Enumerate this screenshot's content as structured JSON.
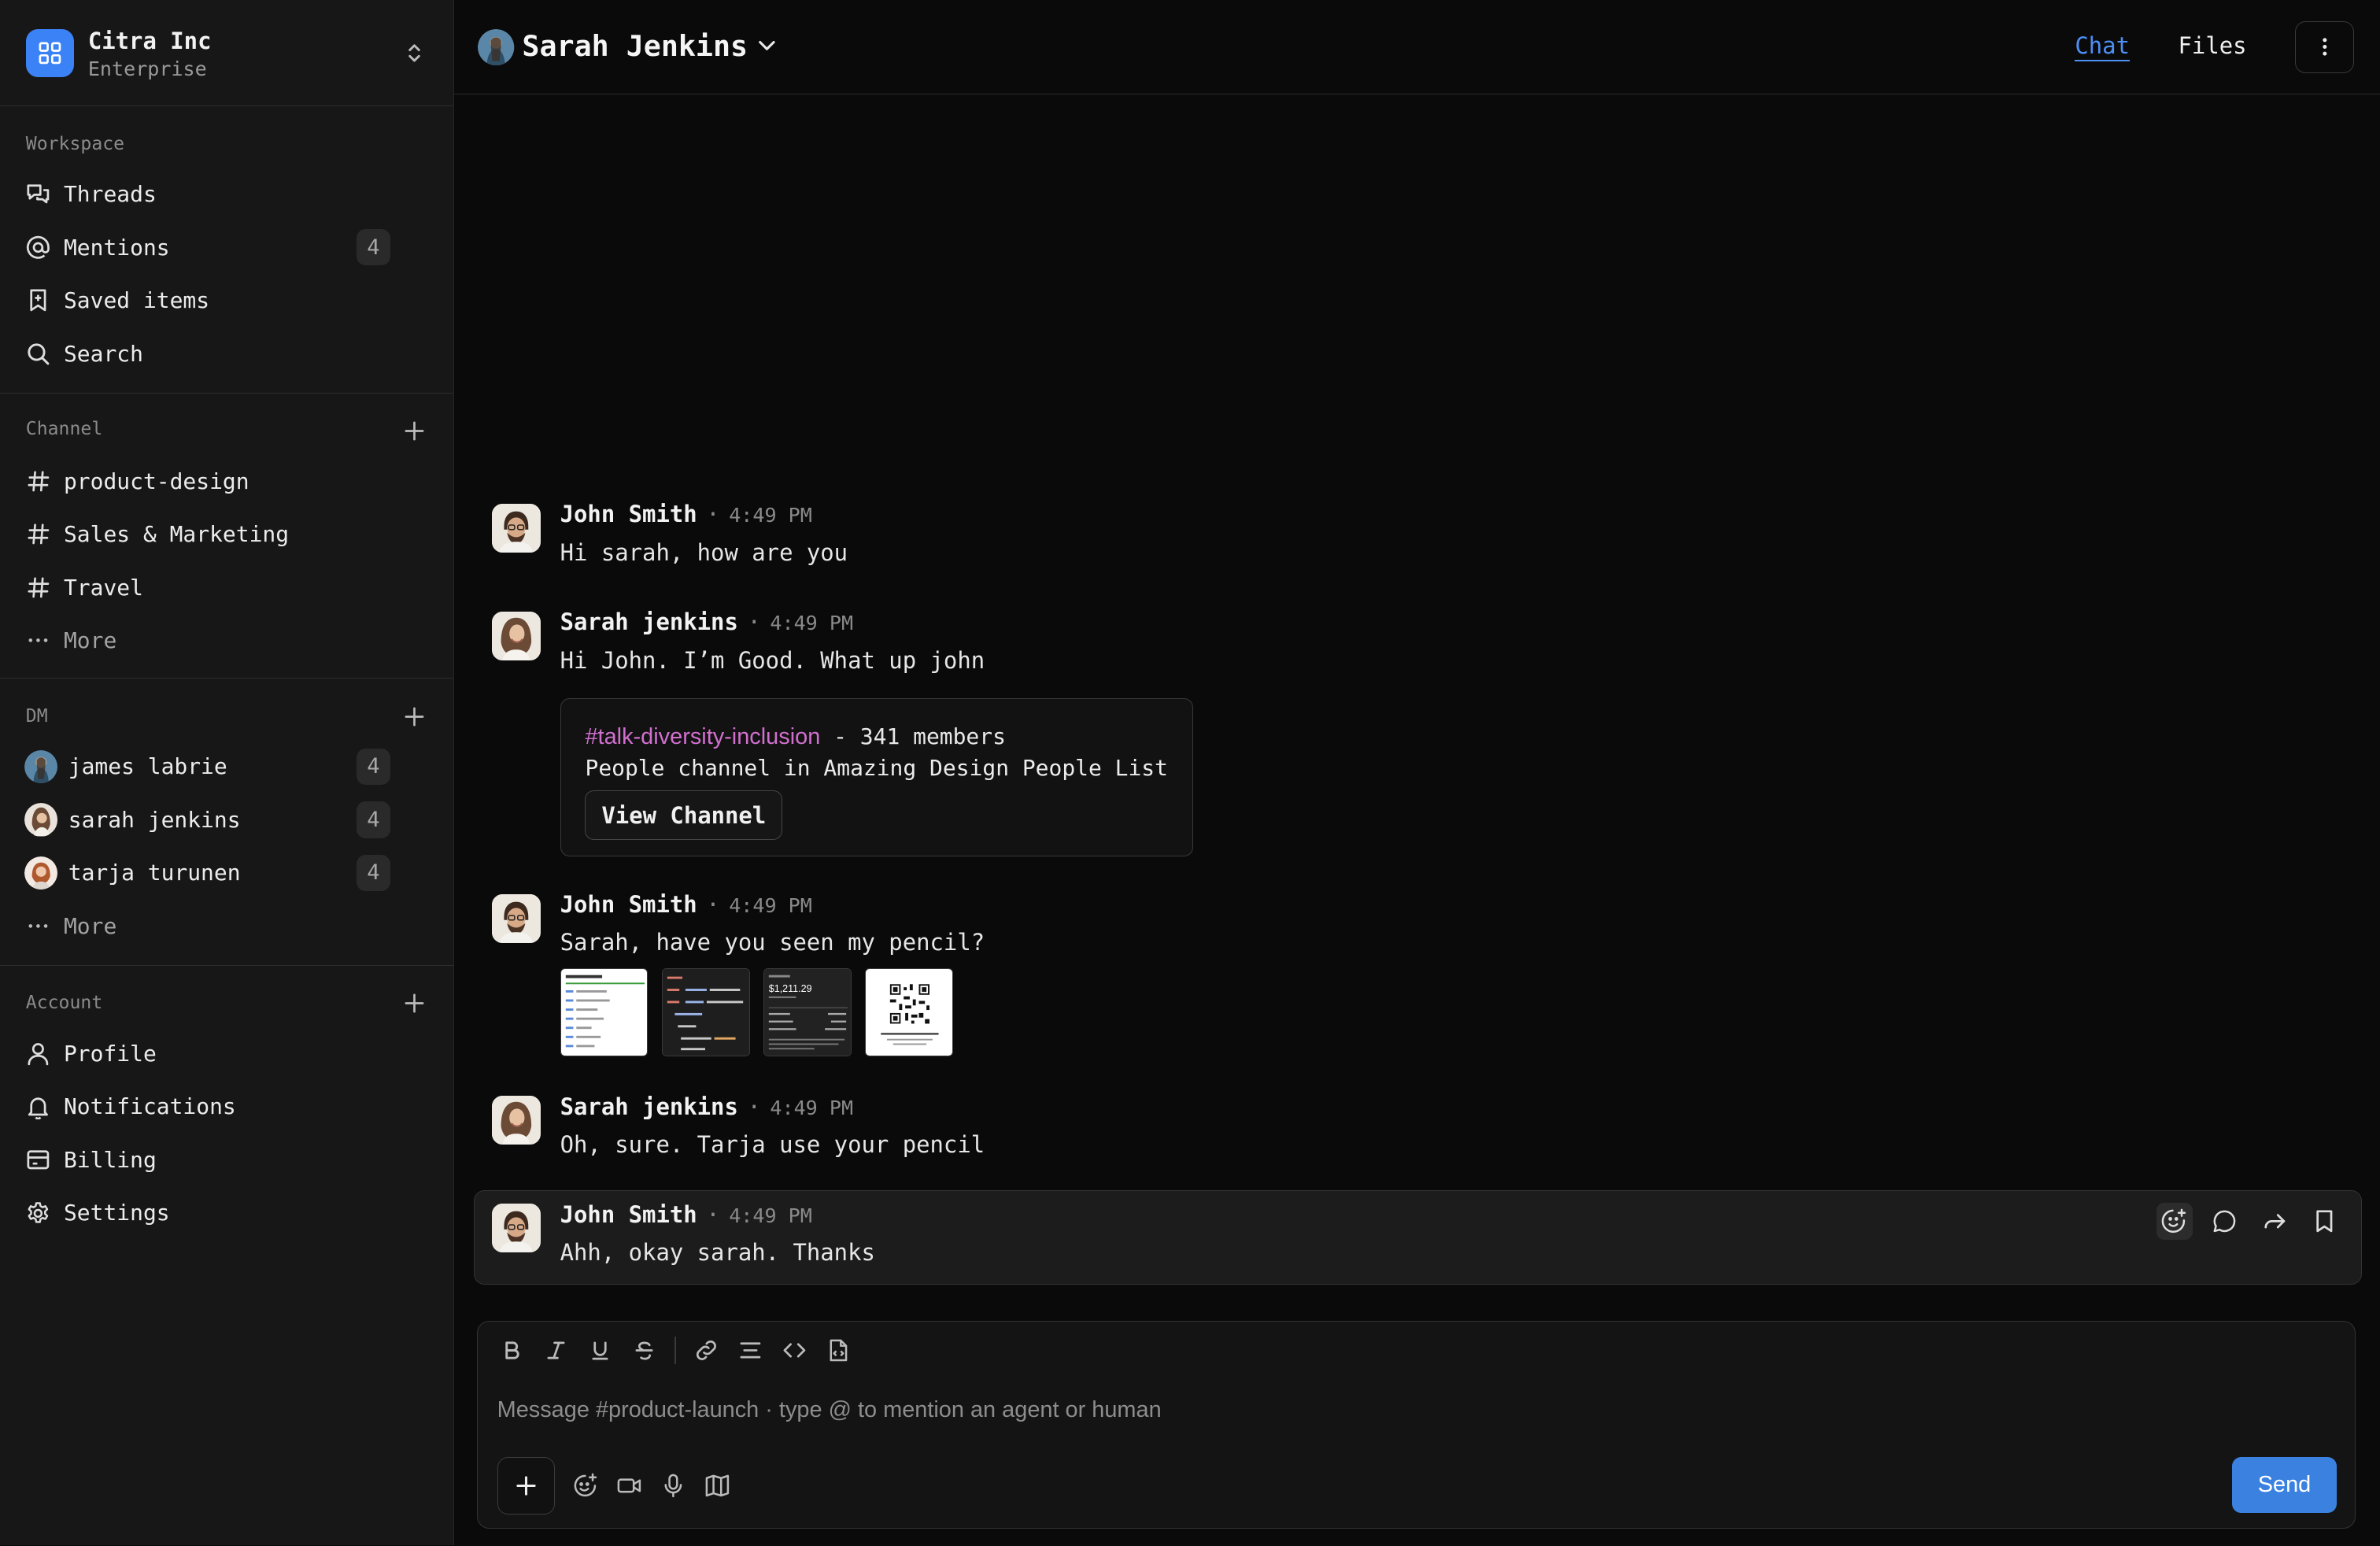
{
  "org": {
    "name": "Citra Inc",
    "plan": "Enterprise"
  },
  "sidebar": {
    "workspace": {
      "title": "Workspace",
      "items": [
        {
          "label": "Threads",
          "icon": "threads-icon"
        },
        {
          "label": "Mentions",
          "icon": "at-icon",
          "badge": "4"
        },
        {
          "label": "Saved items",
          "icon": "bookmark-icon"
        },
        {
          "label": "Search",
          "icon": "search-icon"
        }
      ]
    },
    "channel": {
      "title": "Channel",
      "items": [
        {
          "label": "product-design"
        },
        {
          "label": "Sales & Marketing"
        },
        {
          "label": "Travel"
        }
      ],
      "more": "More"
    },
    "dm": {
      "title": "DM",
      "items": [
        {
          "label": "james labrie",
          "badge": "4"
        },
        {
          "label": "sarah jenkins",
          "badge": "4"
        },
        {
          "label": "tarja turunen",
          "badge": "4"
        }
      ],
      "more": "More"
    },
    "account": {
      "title": "Account",
      "items": [
        {
          "label": "Profile",
          "icon": "user-icon"
        },
        {
          "label": "Notifications",
          "icon": "bell-icon"
        },
        {
          "label": "Billing",
          "icon": "billing-icon"
        },
        {
          "label": "Settings",
          "icon": "gear-icon"
        }
      ]
    }
  },
  "header": {
    "name": "Sarah Jenkins",
    "tabs": {
      "chat": "Chat",
      "files": "Files"
    }
  },
  "messages": [
    {
      "author": "John Smith",
      "time": "4:49 PM",
      "text": "Hi sarah, how are you"
    },
    {
      "author": "Sarah jenkins",
      "time": "4:49 PM",
      "text": "Hi John. I’m Good. What up john"
    },
    {
      "author": "John Smith",
      "time": "4:49 PM",
      "text": "Sarah, have you seen my pencil?"
    },
    {
      "author": "Sarah jenkins",
      "time": "4:49 PM",
      "text": "Oh, sure. Tarja use your pencil"
    },
    {
      "author": "John Smith",
      "time": "4:49 PM",
      "text": "Ahh, okay sarah. Thanks"
    }
  ],
  "channel_card": {
    "channel": "#talk-diversity-inclusion",
    "members": "- 341 members",
    "description": "People channel in Amazing Design People List",
    "button": "View Channel"
  },
  "thumbnails": {
    "receipt_amount": "$1,211.29"
  },
  "composer": {
    "placeholder": "Message #product-launch · type @ to mention an agent or human",
    "send": "Send"
  },
  "colors": {
    "accent": "#3b82e0",
    "channel_link": "#d16fcf",
    "background": "#0a0a0a",
    "sidebar": "#171717"
  }
}
